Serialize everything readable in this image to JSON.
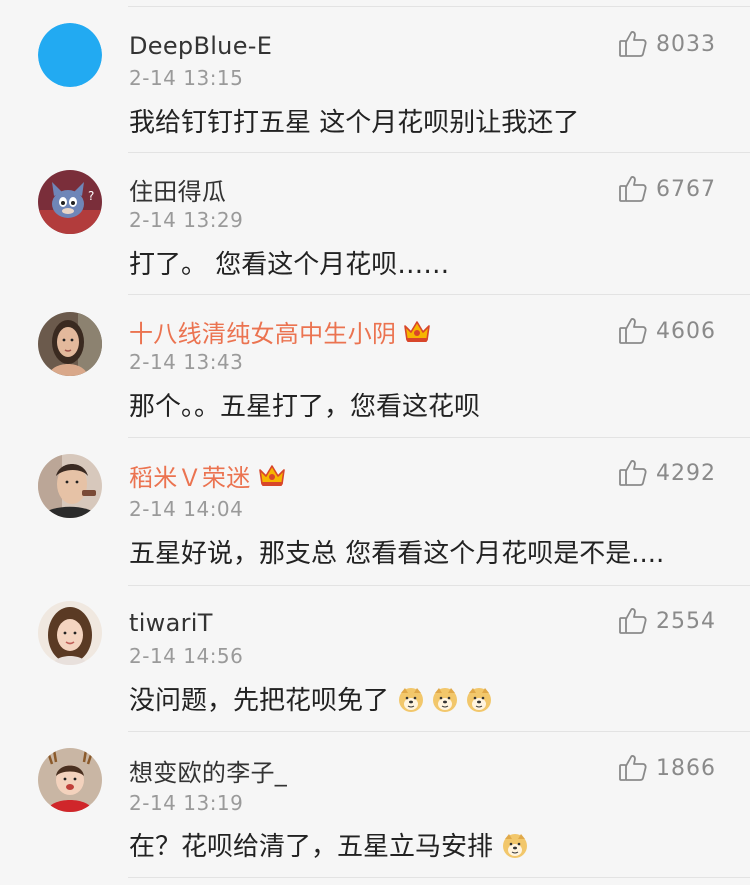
{
  "comments": [
    {
      "user": "DeepBlue-E",
      "vip": false,
      "time": "2-14 13:15",
      "text": "我给钉钉打五星 这个月花呗别让我还了",
      "emojis": [],
      "likes": "8033",
      "avatar": "blue-circle-avatar"
    },
    {
      "user": "住田得瓜",
      "vip": false,
      "time": "2-14 13:29",
      "text": "打了。 您看这个月花呗……",
      "emojis": [],
      "likes": "6767",
      "avatar": "cartoon-cat-avatar"
    },
    {
      "user": "十八线清纯女高中生小阴",
      "vip": true,
      "time": "2-14 13:43",
      "text": "那个。。五星打了，您看这花呗",
      "emojis": [],
      "likes": "4606",
      "avatar": "woman-portrait-avatar"
    },
    {
      "user": "稻米Ｖ荣迷",
      "vip": true,
      "time": "2-14 14:04",
      "text": "五星好说，那支总 您看看这个月花呗是不是....",
      "emojis": [],
      "likes": "4292",
      "avatar": "man-portrait-avatar"
    },
    {
      "user": "tiwariT",
      "vip": false,
      "time": "2-14 14:56",
      "text": "没问题，先把花呗免了",
      "emojis": [
        "doge-emoji",
        "doge-emoji",
        "doge-emoji"
      ],
      "likes": "2554",
      "avatar": "girl-portrait-avatar"
    },
    {
      "user": "想变欧的李子_",
      "vip": false,
      "time": "2-14 13:19",
      "text": "在？花呗给清了，五星立马安排",
      "emojis": [
        "doge-emoji"
      ],
      "likes": "1866",
      "avatar": "child-christmas-avatar"
    }
  ],
  "colors": {
    "background": "#f6f6f6",
    "vip_name": "#eb7350",
    "time": "#9a9a9a",
    "like": "#8a8a8a"
  }
}
